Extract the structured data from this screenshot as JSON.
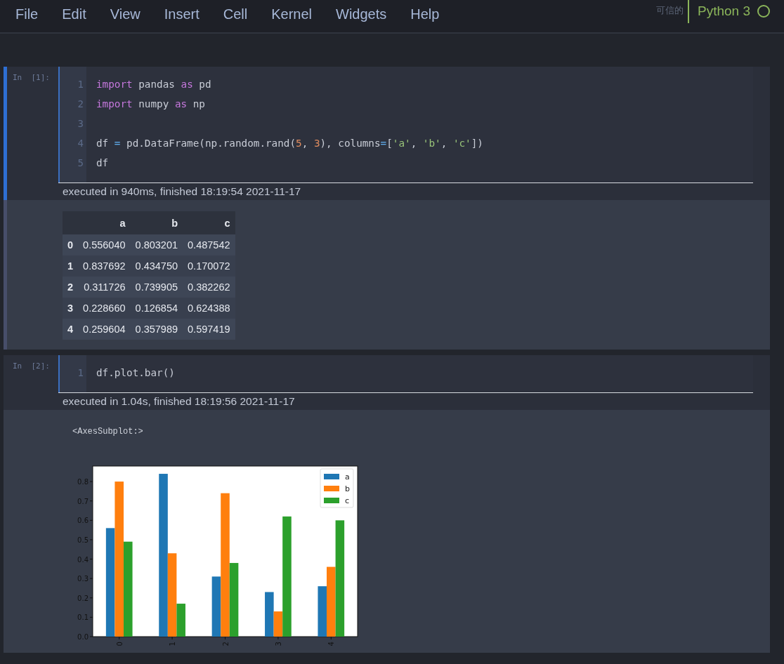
{
  "menu": [
    {
      "label": "File"
    },
    {
      "label": "Edit"
    },
    {
      "label": "View"
    },
    {
      "label": "Insert"
    },
    {
      "label": "Cell"
    },
    {
      "label": "Kernel"
    },
    {
      "label": "Widgets"
    },
    {
      "label": "Help"
    }
  ],
  "trust_label": "可信的",
  "kernel": {
    "name": "Python 3",
    "busy": false
  },
  "cells": [
    {
      "prompt": "In  [1]:",
      "selected": true,
      "lines": [
        {
          "number": "1",
          "tokens": [
            {
              "kind": "keyword",
              "text": "import"
            },
            {
              "kind": "plain",
              "text": " pandas "
            },
            {
              "kind": "keyword",
              "text": "as"
            },
            {
              "kind": "plain",
              "text": " pd"
            }
          ]
        },
        {
          "number": "2",
          "tokens": [
            {
              "kind": "keyword",
              "text": "import"
            },
            {
              "kind": "plain",
              "text": " numpy "
            },
            {
              "kind": "keyword",
              "text": "as"
            },
            {
              "kind": "plain",
              "text": " np"
            }
          ]
        },
        {
          "number": "3"
        },
        {
          "number": "4",
          "tokens": [
            {
              "kind": "plain",
              "text": "df "
            },
            {
              "kind": "operator",
              "text": "="
            },
            {
              "kind": "plain",
              "text": " pd.DataFrame(np.random.rand("
            },
            {
              "kind": "number",
              "text": "5"
            },
            {
              "kind": "plain",
              "text": ", "
            },
            {
              "kind": "number",
              "text": "3"
            },
            {
              "kind": "plain",
              "text": "), columns"
            },
            {
              "kind": "operator",
              "text": "="
            },
            {
              "kind": "plain",
              "text": "["
            },
            {
              "kind": "string",
              "text": "'a'"
            },
            {
              "kind": "plain",
              "text": ", "
            },
            {
              "kind": "string",
              "text": "'b'"
            },
            {
              "kind": "plain",
              "text": ", "
            },
            {
              "kind": "string",
              "text": "'c'"
            },
            {
              "kind": "plain",
              "text": "])"
            }
          ]
        },
        {
          "number": "5",
          "tokens": [
            {
              "kind": "plain",
              "text": "df"
            }
          ]
        }
      ],
      "timing": "executed in 940ms, finished 18:19:54 2021-11-17",
      "output": {
        "kind": "table",
        "columns": [
          "a",
          "b",
          "c"
        ],
        "rows": [
          {
            "index": "0",
            "values": [
              "0.556040",
              "0.803201",
              "0.487542"
            ]
          },
          {
            "index": "1",
            "values": [
              "0.837692",
              "0.434750",
              "0.170072"
            ]
          },
          {
            "index": "2",
            "values": [
              "0.311726",
              "0.739905",
              "0.382262"
            ]
          },
          {
            "index": "3",
            "values": [
              "0.228660",
              "0.126854",
              "0.624388"
            ]
          },
          {
            "index": "4",
            "values": [
              "0.259604",
              "0.357989",
              "0.597419"
            ]
          }
        ]
      }
    },
    {
      "prompt": "In  [2]:",
      "selected": false,
      "lines": [
        {
          "number": "1",
          "tokens": [
            {
              "kind": "plain",
              "text": "df.plot.bar()"
            }
          ]
        }
      ],
      "timing": "executed in 1.04s, finished 18:19:56 2021-11-17",
      "output": {
        "kind": "chart",
        "text": "<AxesSubplot:>",
        "chart_data": {
          "type": "bar",
          "categories": [
            "0",
            "1",
            "2",
            "3",
            "4"
          ],
          "series": [
            {
              "name": "a",
              "color": "#1f77b4",
              "values": [
                0.56,
                0.84,
                0.31,
                0.23,
                0.26
              ]
            },
            {
              "name": "b",
              "color": "#ff7f0e",
              "values": [
                0.8,
                0.43,
                0.74,
                0.13,
                0.36
              ]
            },
            {
              "name": "c",
              "color": "#2ca02c",
              "values": [
                0.49,
                0.17,
                0.38,
                0.62,
                0.6
              ]
            }
          ],
          "legend": true,
          "ylim": [
            0,
            0.88
          ],
          "yticks": [
            {
              "value": 0,
              "label": "0.0"
            },
            {
              "value": 0.1,
              "label": "0.1"
            },
            {
              "value": 0.2,
              "label": "0.2"
            },
            {
              "value": 0.3,
              "label": "0.3"
            },
            {
              "value": 0.4,
              "label": "0.4"
            },
            {
              "value": 0.5,
              "label": "0.5"
            },
            {
              "value": 0.6,
              "label": "0.6"
            },
            {
              "value": 0.7,
              "label": "0.7"
            },
            {
              "value": 0.8,
              "label": "0.8"
            }
          ]
        }
      }
    }
  ]
}
